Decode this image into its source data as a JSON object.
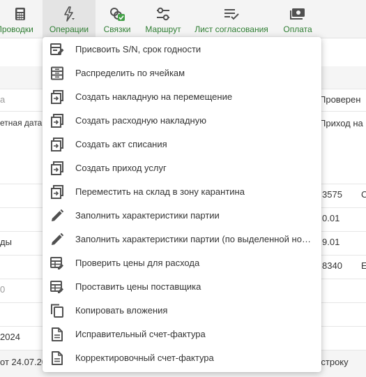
{
  "toolbar": {
    "items": [
      {
        "label": "Проводки",
        "icon": "calculator-icon"
      },
      {
        "label": "Операции",
        "icon": "lightning-icon"
      },
      {
        "label": "Связки",
        "icon": "links-check-icon"
      },
      {
        "label": "Маршрут",
        "icon": "route-icon"
      },
      {
        "label": "Лист согласования",
        "icon": "list-check-icon"
      },
      {
        "label": "Оплата",
        "icon": "cash-icon"
      }
    ]
  },
  "background": {
    "left": [
      "а",
      "етная дата",
      "ды",
      "0",
      "2024",
      "от 24.07.20"
    ],
    "right": [
      "Проверен",
      "Приход на",
      "3575",
      "С",
      "0.01",
      "9.01",
      "8340",
      "Е",
      "ь строку"
    ]
  },
  "menu": {
    "items": [
      {
        "label": "Присвоить S/N, срок годности",
        "icon": "assign-serial-icon"
      },
      {
        "label": "Распределить по ячейкам",
        "icon": "cells-icon"
      },
      {
        "label": "Создать накладную на перемещение",
        "icon": "create-document-icon"
      },
      {
        "label": "Создать расходную накладную",
        "icon": "create-document-icon"
      },
      {
        "label": "Создать акт списания",
        "icon": "create-document-icon"
      },
      {
        "label": "Создать приход услуг",
        "icon": "create-document-icon"
      },
      {
        "label": "Переместить на склад в зону карантина",
        "icon": "create-document-icon"
      },
      {
        "label": "Заполнить характеристики партии",
        "icon": "pencil-icon"
      },
      {
        "label": "Заполнить характеристики партии (по выделенной ном...",
        "icon": "pencil-icon"
      },
      {
        "label": "Проверить цены для расхода",
        "icon": "price-table-icon"
      },
      {
        "label": "Проставить цены поставщика",
        "icon": "price-table-icon"
      },
      {
        "label": "Копировать вложения",
        "icon": "copy-icon"
      },
      {
        "label": "Исправительный счет-фактура",
        "icon": "invoice-icon"
      },
      {
        "label": "Корректировочный счет-фактура",
        "icon": "invoice-icon"
      }
    ]
  },
  "colors": {
    "accent": "#2e7d32",
    "icon": "#505050",
    "badge": "#43a047"
  }
}
